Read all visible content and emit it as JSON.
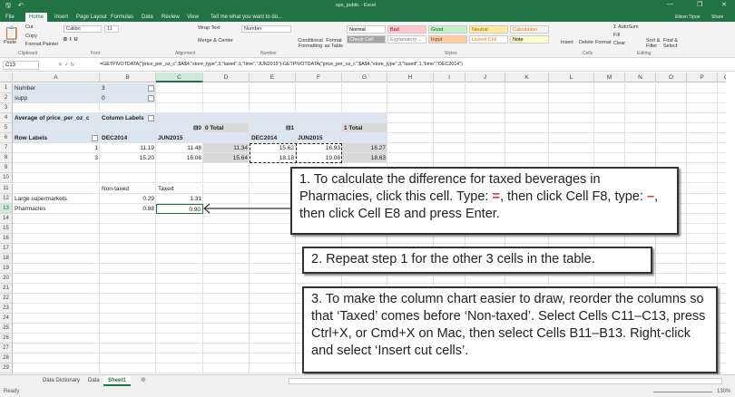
{
  "window": {
    "title": "sps_public - Excel",
    "user": "Eileen Tipoe",
    "share": "Share"
  },
  "tabs": [
    "File",
    "Home",
    "Insert",
    "Page Layout",
    "Formulas",
    "Data",
    "Review",
    "View"
  ],
  "tell_me": "Tell me what you want to do...",
  "ribbon": {
    "clipboard": {
      "paste": "Paste",
      "cut": "Cut",
      "copy": "Copy",
      "format_painter": "Format Painter",
      "label": "Clipboard"
    },
    "font": {
      "name": "Calibri",
      "size": "11",
      "label": "Font"
    },
    "alignment": {
      "wrap": "Wrap Text",
      "merge": "Merge & Center",
      "label": "Alignment"
    },
    "number": {
      "format": "Number",
      "label": "Number"
    },
    "styles": {
      "conditional": "Conditional Formatting",
      "format_table": "Format as Table",
      "items": [
        "Normal",
        "Bad",
        "Good",
        "Neutral",
        "Calculation",
        "Check Cell",
        "Explanatory ...",
        "Input",
        "Linked Cell",
        "Note"
      ],
      "label": "Styles"
    },
    "cells": {
      "insert": "Insert",
      "delete": "Delete",
      "format": "Format",
      "label": "Cells"
    },
    "editing": {
      "autosum": "AutoSum",
      "fill": "Fill",
      "clear": "Clear",
      "sort": "Sort & Filter",
      "find": "Find & Select",
      "label": "Editing"
    }
  },
  "formula_bar": {
    "name_box": "C13",
    "formula": "=GETPIVOTDATA(\"price_per_oz_c\",$A$4,\"store_type\",3,\"taxed\",1,\"time\",\"JUN2015\")-GETPIVOTDATA(\"price_per_oz_c\",$A$4,\"store_type\",3,\"taxed\",1,\"time\",\"DEC2014\")"
  },
  "columns": [
    "A",
    "B",
    "C",
    "D",
    "E",
    "F",
    "G",
    "H",
    "I",
    "J",
    "K",
    "L",
    "M",
    "N",
    "O",
    "P",
    "Q"
  ],
  "cells": [
    [
      1,
      0,
      "Number"
    ],
    [
      1,
      1,
      "3"
    ],
    [
      2,
      0,
      "supp"
    ],
    [
      2,
      1,
      "0"
    ],
    [
      4,
      0,
      "Average of price_per_oz_c"
    ],
    [
      4,
      1,
      "Column Labels"
    ],
    [
      5,
      2,
      "⊟0"
    ],
    [
      5,
      3,
      "0 Total"
    ],
    [
      5,
      4,
      "⊟1"
    ],
    [
      5,
      6,
      "1 Total"
    ],
    [
      6,
      0,
      "Row Labels"
    ],
    [
      6,
      1,
      "DEC2014"
    ],
    [
      6,
      2,
      "JUN2015"
    ],
    [
      6,
      4,
      "DEC2014"
    ],
    [
      6,
      5,
      "JUN2015"
    ],
    [
      7,
      0,
      "1"
    ],
    [
      7,
      1,
      "11.19"
    ],
    [
      7,
      2,
      "11.48"
    ],
    [
      7,
      3,
      "11.34"
    ],
    [
      7,
      4,
      "15.62"
    ],
    [
      7,
      5,
      "16.93"
    ],
    [
      7,
      6,
      "16.27"
    ],
    [
      8,
      0,
      "3"
    ],
    [
      8,
      1,
      "15.20"
    ],
    [
      8,
      2,
      "16.08"
    ],
    [
      8,
      3,
      "15.64"
    ],
    [
      8,
      4,
      "18.18"
    ],
    [
      8,
      5,
      "19.08"
    ],
    [
      8,
      6,
      "18.63"
    ],
    [
      11,
      1,
      "Non-taxed"
    ],
    [
      11,
      2,
      "Taxed"
    ],
    [
      12,
      0,
      "Large supermarkets"
    ],
    [
      12,
      1,
      "0.29"
    ],
    [
      12,
      2,
      "1.31"
    ],
    [
      13,
      0,
      "Pharmacies"
    ],
    [
      13,
      1,
      "0.88"
    ],
    [
      13,
      2,
      "0.90"
    ]
  ],
  "callouts": {
    "c1a": "1. To calculate the difference for taxed beverages in Pharmacies, click this cell. Type: ",
    "c1eq": "=",
    "c1b": ", then click Cell F8, type: ",
    "c1minus": "–",
    "c1c": ", then click Cell E8 and press Enter.",
    "c2": "2. Repeat step 1 for the other 3 cells in the table.",
    "c3": "3. To make the column chart easier to draw, reorder the columns so that ‘Taxed’ comes before ‘Non-taxed’. Select Cells C11–C13, press Ctrl+X, or Cmd+X on Mac, then select Cells B11–B13. Right-click and select ‘Insert cut cells’."
  },
  "sheet_tabs": [
    "Data Dictionary",
    "Data",
    "Sheet1"
  ],
  "status": {
    "ready": "Ready",
    "zoom": "130%"
  }
}
